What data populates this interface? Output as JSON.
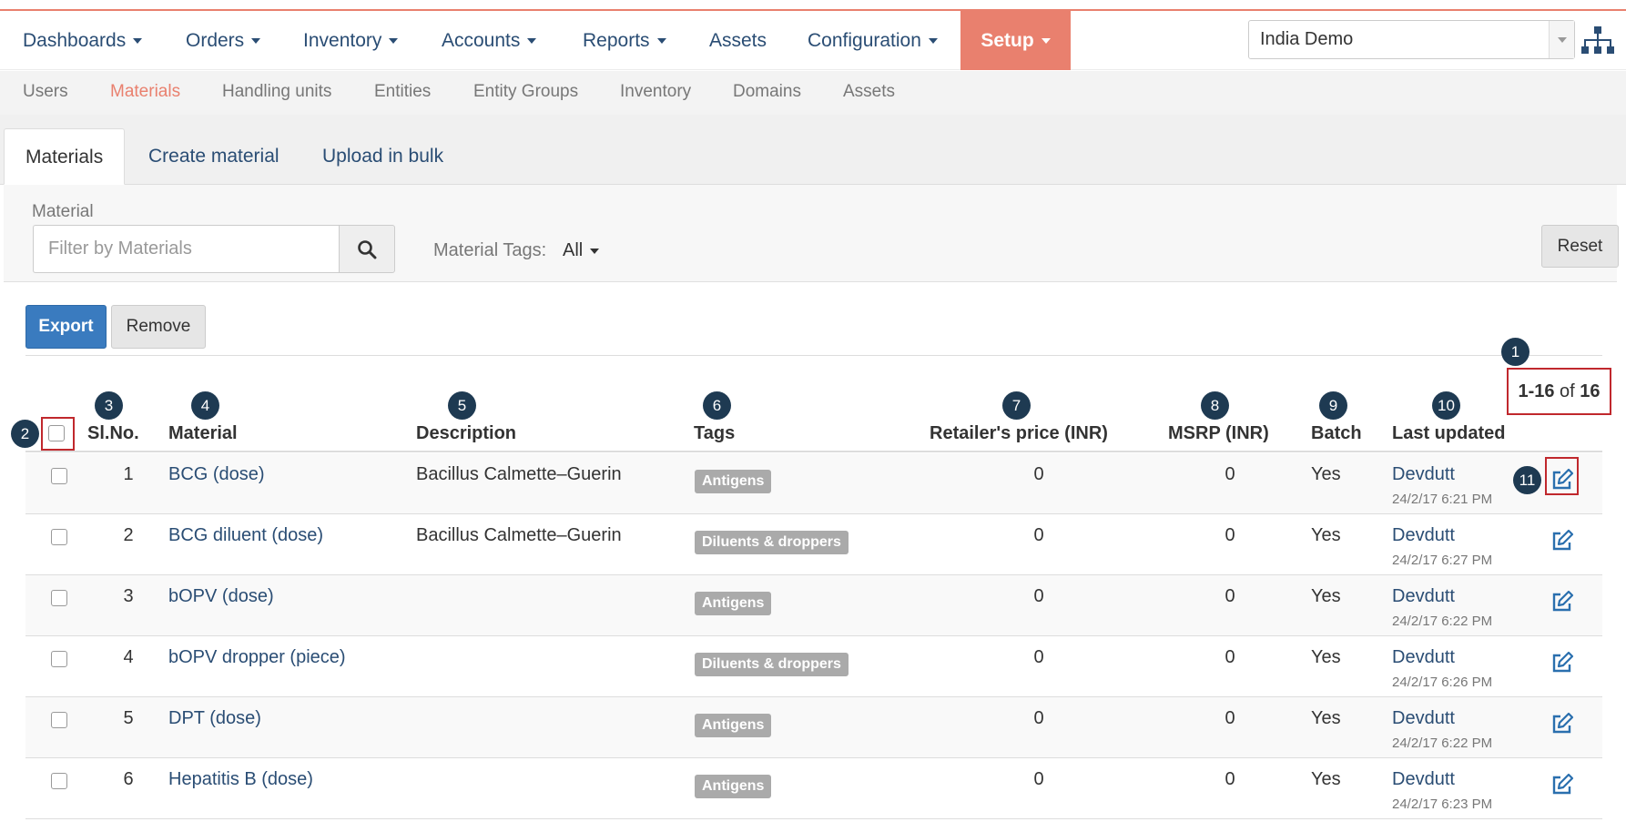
{
  "colors": {
    "accent": "#e9806e",
    "link": "#2a4d74",
    "primary": "#3a7bbf",
    "annotation": "#1e3a52",
    "highlight": "#c0282d"
  },
  "main_nav": {
    "items": [
      {
        "label": "Dashboards",
        "caret": true
      },
      {
        "label": "Orders",
        "caret": true
      },
      {
        "label": "Inventory",
        "caret": true
      },
      {
        "label": "Accounts",
        "caret": true
      },
      {
        "label": "Reports",
        "caret": true
      },
      {
        "label": "Assets",
        "caret": false
      },
      {
        "label": "Configuration",
        "caret": true
      },
      {
        "label": "Setup",
        "caret": true,
        "active": true
      }
    ],
    "domain_select": {
      "value": "India Demo"
    },
    "hierarchy_icon": "sitemap-icon"
  },
  "sub_nav": {
    "items": [
      "Users",
      "Materials",
      "Handling units",
      "Entities",
      "Entity Groups",
      "Inventory",
      "Domains",
      "Assets"
    ],
    "active": "Materials"
  },
  "tabs": [
    "Materials",
    "Create material",
    "Upload in bulk"
  ],
  "filter": {
    "label": "Material",
    "placeholder": "Filter by Materials",
    "search_icon": "search-icon",
    "tags_label": "Material Tags:",
    "tags_value": "All",
    "reset_label": "Reset"
  },
  "actions": {
    "export_label": "Export",
    "remove_label": "Remove"
  },
  "pagination": {
    "range": "1-16",
    "of": "of",
    "total": "16"
  },
  "annotations": [
    "1",
    "2",
    "3",
    "4",
    "5",
    "6",
    "7",
    "8",
    "9",
    "10",
    "11"
  ],
  "table": {
    "headers": {
      "slno": "Sl.No.",
      "material": "Material",
      "description": "Description",
      "tags": "Tags",
      "retail": "Retailer's price (INR)",
      "msrp": "MSRP (INR)",
      "batch": "Batch",
      "updated": "Last updated"
    },
    "rows": [
      {
        "slno": "1",
        "material": "BCG (dose)",
        "description": "Bacillus Calmette–Guerin",
        "tag": "Antigens",
        "retail": "0",
        "msrp": "0",
        "batch": "Yes",
        "user": "Devdutt",
        "time": "24/2/17 6:21 PM"
      },
      {
        "slno": "2",
        "material": "BCG diluent (dose)",
        "description": "Bacillus Calmette–Guerin",
        "tag": "Diluents & droppers",
        "retail": "0",
        "msrp": "0",
        "batch": "Yes",
        "user": "Devdutt",
        "time": "24/2/17 6:27 PM"
      },
      {
        "slno": "3",
        "material": "bOPV (dose)",
        "description": "",
        "tag": "Antigens",
        "retail": "0",
        "msrp": "0",
        "batch": "Yes",
        "user": "Devdutt",
        "time": "24/2/17 6:22 PM"
      },
      {
        "slno": "4",
        "material": "bOPV dropper (piece)",
        "description": "",
        "tag": "Diluents & droppers",
        "retail": "0",
        "msrp": "0",
        "batch": "Yes",
        "user": "Devdutt",
        "time": "24/2/17 6:26 PM"
      },
      {
        "slno": "5",
        "material": "DPT (dose)",
        "description": "",
        "tag": "Antigens",
        "retail": "0",
        "msrp": "0",
        "batch": "Yes",
        "user": "Devdutt",
        "time": "24/2/17 6:22 PM"
      },
      {
        "slno": "6",
        "material": "Hepatitis B (dose)",
        "description": "",
        "tag": "Antigens",
        "retail": "0",
        "msrp": "0",
        "batch": "Yes",
        "user": "Devdutt",
        "time": "24/2/17 6:23 PM"
      }
    ]
  }
}
